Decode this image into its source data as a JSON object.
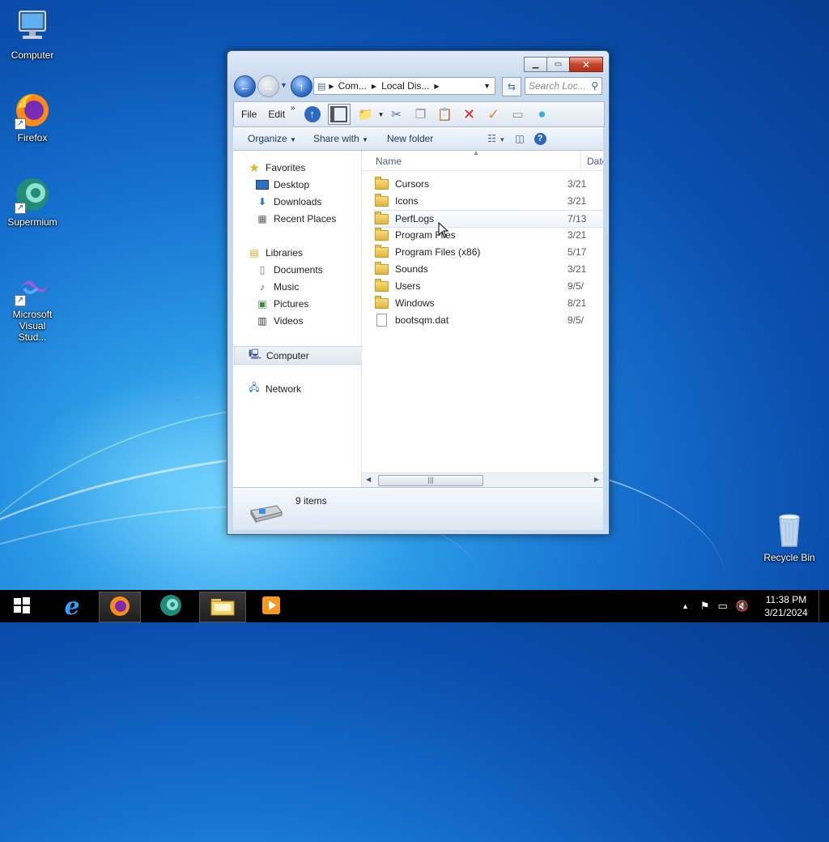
{
  "desktop": {
    "icons": [
      {
        "label": "Computer"
      },
      {
        "label": "Firefox"
      },
      {
        "label": "Supermium"
      },
      {
        "label": "Microsoft Visual Stud..."
      },
      {
        "label": "Recycle Bin"
      }
    ]
  },
  "window": {
    "address": {
      "crumbs": [
        "Com...",
        "Local Dis..."
      ]
    },
    "search": {
      "placeholder": "Search Loc..."
    },
    "menu": {
      "file": "File",
      "edit": "Edit",
      "more": "»"
    },
    "commands": {
      "organize": "Organize",
      "share_with": "Share with",
      "new_folder": "New folder"
    },
    "nav": {
      "favorites": "Favorites",
      "desktop": "Desktop",
      "downloads": "Downloads",
      "recent_places": "Recent Places",
      "libraries": "Libraries",
      "documents": "Documents",
      "music": "Music",
      "pictures": "Pictures",
      "videos": "Videos",
      "computer": "Computer",
      "network": "Network"
    },
    "columns": {
      "name": "Name",
      "date": "Date"
    },
    "files": [
      {
        "name": "Cursors",
        "date": "3/21"
      },
      {
        "name": "Icons",
        "date": "3/21"
      },
      {
        "name": "PerfLogs",
        "date": "7/13"
      },
      {
        "name": "Program Files",
        "date": "3/21"
      },
      {
        "name": "Program Files (x86)",
        "date": "5/17"
      },
      {
        "name": "Sounds",
        "date": "3/21"
      },
      {
        "name": "Users",
        "date": "9/5/"
      },
      {
        "name": "Windows",
        "date": "8/21"
      },
      {
        "name": "bootsqm.dat",
        "date": "9/5/"
      }
    ],
    "status": {
      "item_count": "9 items"
    }
  },
  "taskbar": {
    "time": "11:38 PM",
    "date": "3/21/2024"
  },
  "colors": {
    "accent": "#1672cf",
    "close": "#c6452b"
  }
}
